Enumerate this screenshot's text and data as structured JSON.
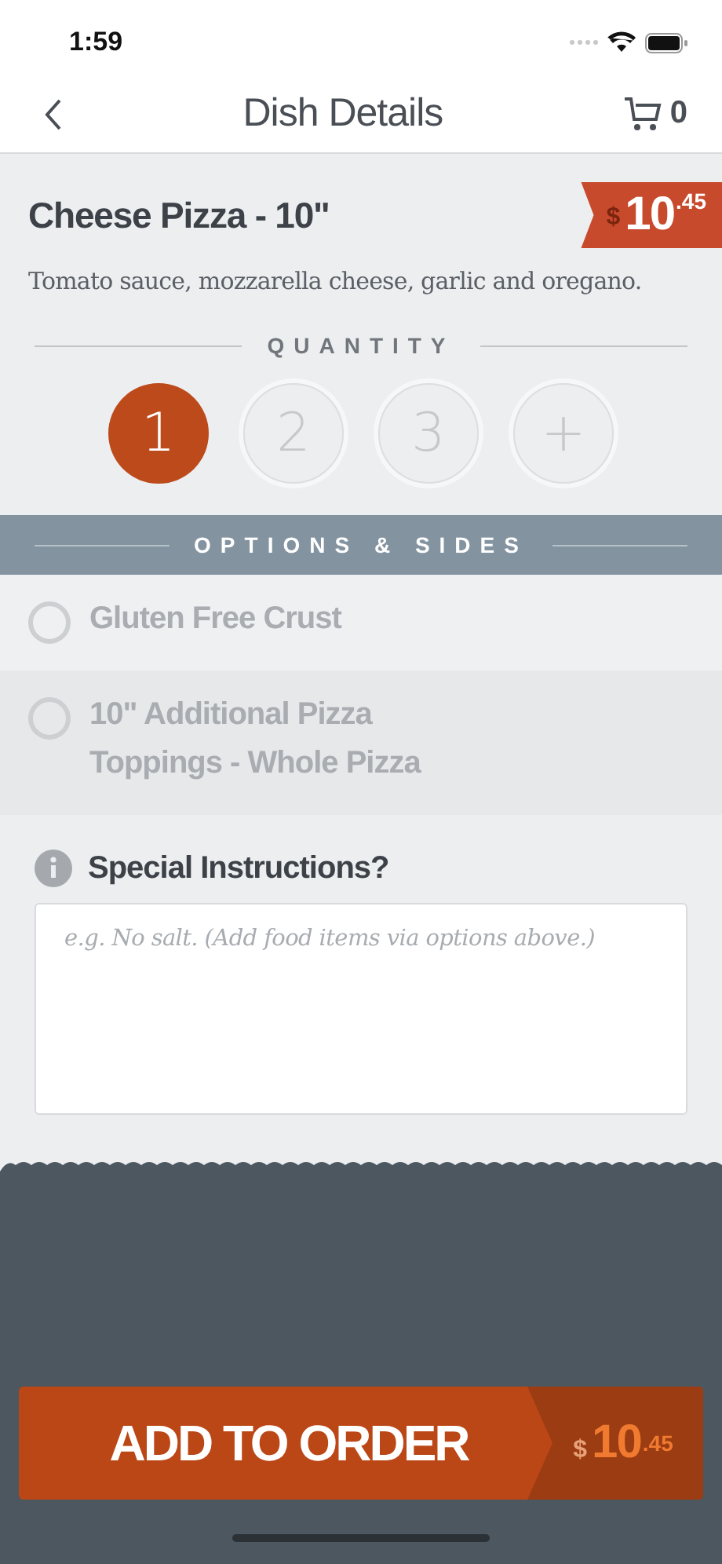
{
  "status_bar": {
    "time": "1:59"
  },
  "nav": {
    "title": "Dish Details",
    "cart_count": "0"
  },
  "dish": {
    "name": "Cheese Pizza - 10\"",
    "price": {
      "currency": "$",
      "whole": "10",
      "cents": ".45"
    },
    "description": "Tomato sauce, mozzarella cheese, garlic and oregano."
  },
  "quantity": {
    "label": "QUANTITY",
    "choices": [
      {
        "label": "1",
        "selected": true
      },
      {
        "label": "2",
        "selected": false
      },
      {
        "label": "3",
        "selected": false
      },
      {
        "label": "+",
        "selected": false
      }
    ]
  },
  "options": {
    "label": "OPTIONS & SIDES",
    "items": [
      {
        "label": "Gluten Free Crust",
        "checked": false
      },
      {
        "label": "10\" Additional Pizza Toppings - Whole Pizza",
        "checked": false
      }
    ]
  },
  "instructions": {
    "label": "Special Instructions?",
    "placeholder": "e.g. No salt. (Add food items via options above.)"
  },
  "order_button": {
    "label": "ADD TO ORDER",
    "price": {
      "currency": "$",
      "whole": "10",
      "cents": ".45"
    }
  }
}
